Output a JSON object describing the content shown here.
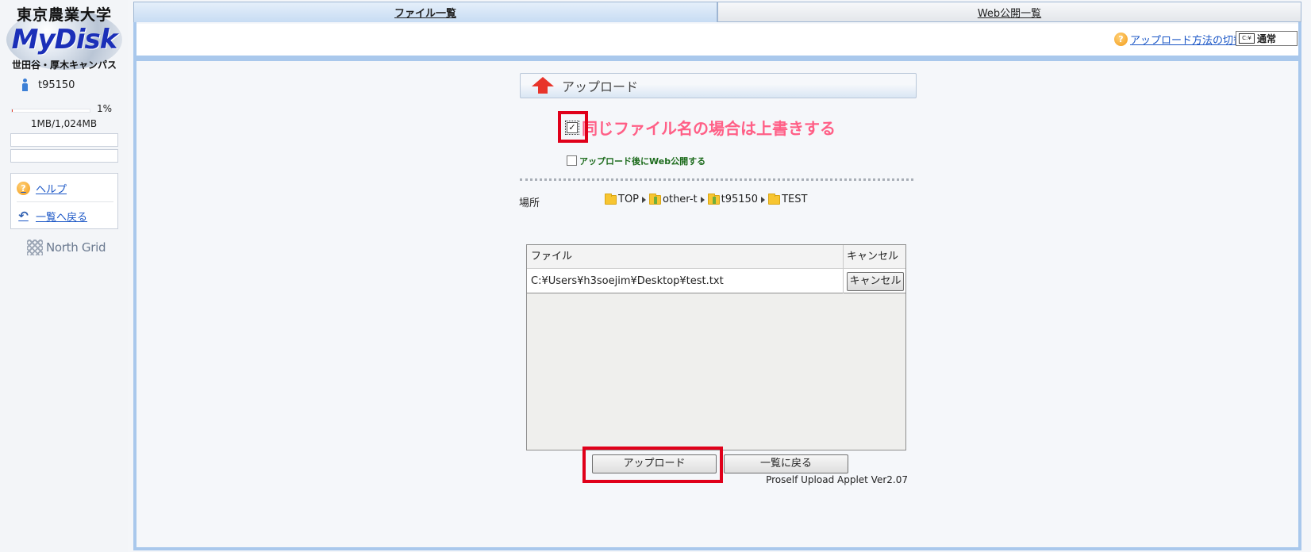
{
  "sidebar": {
    "logo": {
      "university": "東京農業大学",
      "brand": "MyDisk",
      "campus": "世田谷・厚木キャンパス"
    },
    "user": "t95150",
    "quota": {
      "percent": 1,
      "percent_label": "1%",
      "usage": "1MB/1,024MB"
    },
    "links": [
      {
        "label": "ヘルプ",
        "icon": "help-icon"
      },
      {
        "label": "一覧へ戻る",
        "icon": "back-arrow-icon"
      }
    ],
    "footer_logo": "North Grid"
  },
  "tabs": [
    {
      "label": "ファイル一覧",
      "active": true
    },
    {
      "label": "Web公開一覧",
      "active": false
    }
  ],
  "toolbar": {
    "upload_method_link": "アップロード方法の切替",
    "mode_icon_text": "C:¥",
    "mode_label": "通常"
  },
  "upload": {
    "title": "アップロード",
    "overwrite_label": "同じファイル名の場合は上書きする",
    "overwrite_checked": true,
    "web_publish_label": "アップロード後にWeb公開する",
    "web_publish_checked": false,
    "location_label": "場所",
    "path": [
      "TOP",
      "other-t",
      "t95150",
      "TEST"
    ],
    "table": {
      "headers": [
        "ファイル",
        "キャンセル"
      ],
      "rows": [
        {
          "file": "C:¥Users¥h3soejim¥Desktop¥test.txt",
          "action": "キャンセル"
        }
      ]
    },
    "upload_button": "アップロード",
    "back_button": "一覧に戻る",
    "version": "Proself Upload Applet Ver2.07"
  },
  "colors": {
    "highlight": "#e0001a",
    "overwrite_text": "#ff5f86",
    "web_publish_text": "#1c6b1c",
    "frame": "#a9c8ec"
  }
}
